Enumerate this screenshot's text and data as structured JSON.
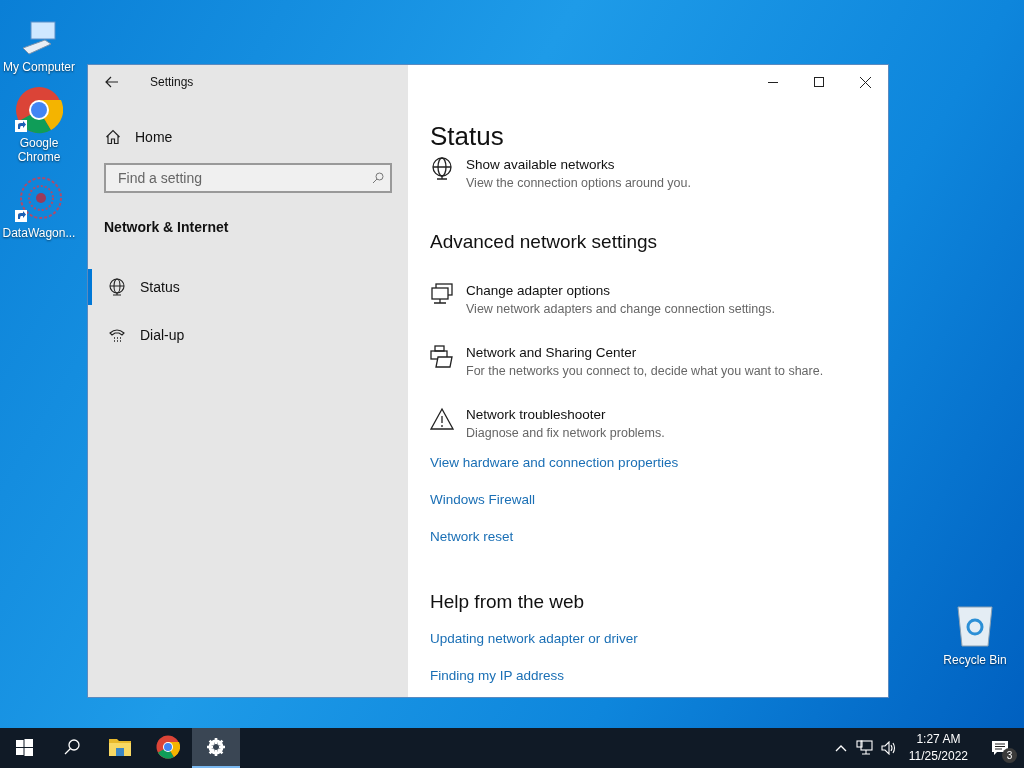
{
  "desktop_icons": [
    {
      "label": "My Computer",
      "kind": "computer"
    },
    {
      "label": "Google Chrome",
      "kind": "chrome"
    },
    {
      "label": "DataWagon...",
      "kind": "app"
    }
  ],
  "recycle_bin": {
    "label": "Recycle Bin"
  },
  "window": {
    "title": "Settings",
    "sidebar": {
      "home": "Home",
      "search": {
        "placeholder": "Find a setting"
      },
      "section": "Network & Internet",
      "items": [
        {
          "label": "Status",
          "selected": true
        },
        {
          "label": "Dial-up",
          "selected": false
        }
      ]
    },
    "content": {
      "title": "Status",
      "blocks": [
        {
          "kind": "networks",
          "title": "Show available networks",
          "description": "View the connection options around you."
        },
        {
          "kind": "heading",
          "text": "Advanced network settings"
        },
        {
          "kind": "adapters",
          "title": "Change adapter options",
          "description": "View network adapters and change connection settings."
        },
        {
          "kind": "sharing",
          "title": "Network and Sharing Center",
          "description": "For the networks you connect to, decide what you want to share."
        },
        {
          "kind": "troubleshooter",
          "title": "Network troubleshooter",
          "description": "Diagnose and fix network problems."
        },
        {
          "kind": "link",
          "text": "View hardware and connection properties"
        },
        {
          "kind": "link",
          "text": "Windows Firewall"
        },
        {
          "kind": "link",
          "text": "Network reset"
        },
        {
          "kind": "heading",
          "text": "Help from the web"
        },
        {
          "kind": "link",
          "text": "Updating network adapter or driver"
        },
        {
          "kind": "link",
          "text": "Finding my IP address"
        }
      ]
    }
  },
  "taskbar": {
    "apps": [
      {
        "kind": "start",
        "selected": false
      },
      {
        "kind": "search",
        "selected": false
      },
      {
        "kind": "explorer",
        "selected": false
      },
      {
        "kind": "chrome",
        "selected": false
      },
      {
        "kind": "settings",
        "selected": true
      }
    ],
    "time": "1:27 AM",
    "date": "11/25/2022",
    "notification_count": "3"
  }
}
